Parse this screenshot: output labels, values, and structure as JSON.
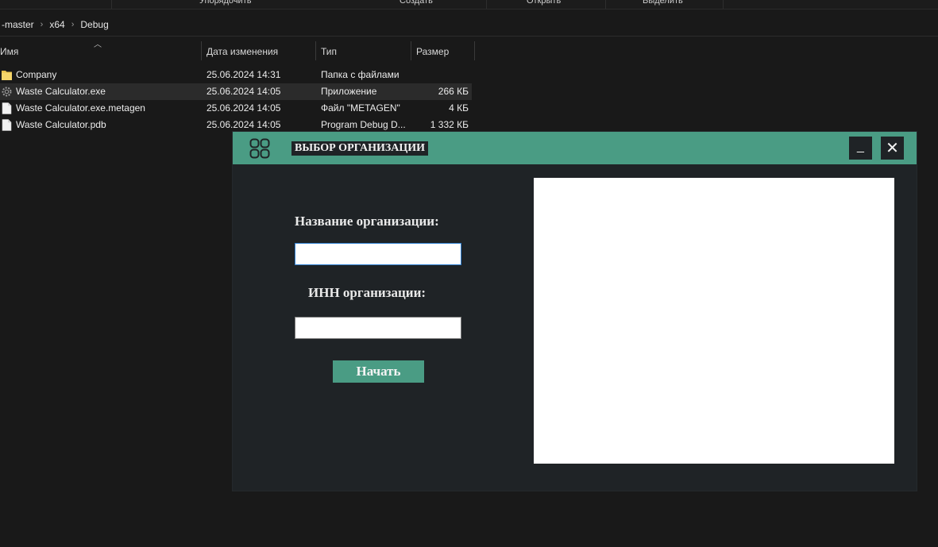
{
  "explorer": {
    "commands": [
      "Упорядочить",
      "Создать",
      "Открыть",
      "Выделить"
    ],
    "breadcrumb": [
      "-master",
      "x64",
      "Debug"
    ],
    "columns": {
      "name": "Имя",
      "date": "Дата изменения",
      "type": "Тип",
      "size": "Размер"
    },
    "files": [
      {
        "name": "Company",
        "date": "25.06.2024 14:31",
        "type": "Папка с файлами",
        "size": "",
        "icon": "folder-icon"
      },
      {
        "name": "Waste Calculator.exe",
        "date": "25.06.2024 14:05",
        "type": "Приложение",
        "size": "266 КБ",
        "icon": "gear-app-icon"
      },
      {
        "name": "Waste Calculator.exe.metagen",
        "date": "25.06.2024 14:05",
        "type": "Файл \"METAGEN\"",
        "size": "4 КБ",
        "icon": "file-icon"
      },
      {
        "name": "Waste Calculator.pdb",
        "date": "25.06.2024 14:05",
        "type": "Program Debug D...",
        "size": "1 332 КБ",
        "icon": "file-icon"
      }
    ]
  },
  "dialog": {
    "title": "ВЫБОР ОРГАНИЗАЦИИ",
    "minimize_label": "_",
    "close_label": "✕",
    "org_name_label": "Название организации:",
    "org_name_value": "",
    "inn_label": "ИНН организации:",
    "inn_value": "",
    "start_label": "Начать"
  },
  "colors": {
    "accent": "#4a9c84",
    "dialog_bg": "#1f2326",
    "explorer_bg": "#191919"
  }
}
